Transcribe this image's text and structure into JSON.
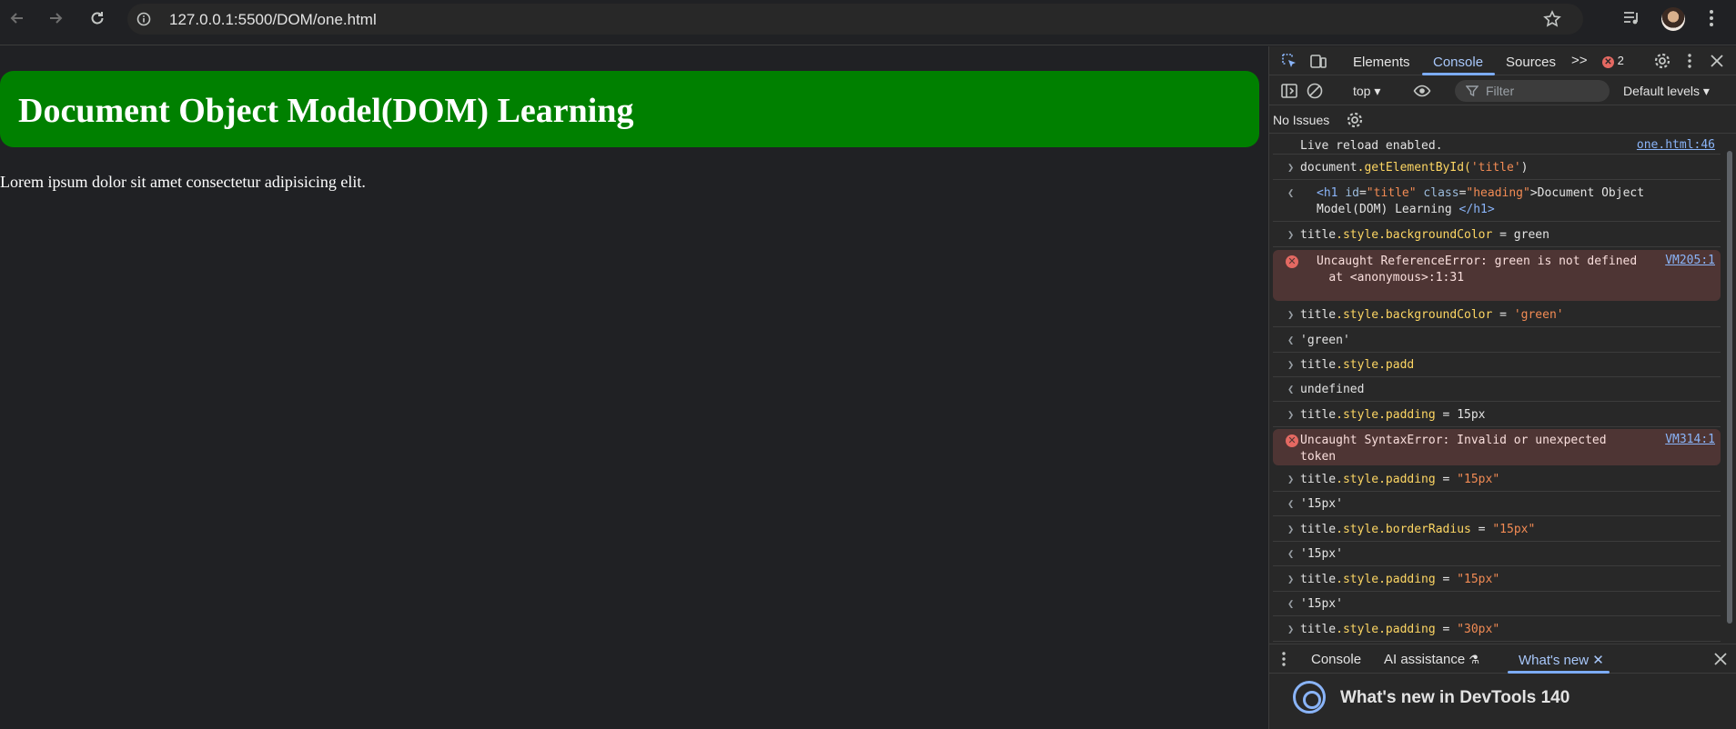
{
  "browser": {
    "url": "127.0.0.1:5500/DOM/one.html",
    "back_icon": "back-arrow-icon",
    "forward_icon": "forward-arrow-icon",
    "reload_icon": "reload-icon"
  },
  "page": {
    "heading": "Document Object Model(DOM) Learning",
    "paragraph": "Lorem ipsum dolor sit amet consectetur adipisicing elit."
  },
  "devtools": {
    "tabs": [
      "Elements",
      "Console",
      "Sources"
    ],
    "more_tabs": ">>",
    "error_count": "2",
    "context": "top ▾",
    "filter_placeholder": "Filter",
    "levels": "Default levels ▾",
    "issues": "No Issues"
  },
  "console": {
    "live_reload": "Live reload enabled.",
    "live_reload_link": "one.html:46",
    "r1_obj": "document",
    "r1_method": ".getElementById(",
    "r1_arg": "'title'",
    "r1_close": ")",
    "r2_open": "<h1",
    "r2_id_attr": "id",
    "r2_id_val": "\"title\"",
    "r2_class_attr": "class",
    "r2_class_val": "\"heading\"",
    "r2_text": ">Document Object Model(DOM) Learning",
    "r2_close": "</h1>",
    "cmd1_obj": "title",
    "cmd1_prop": ".style.backgroundColor",
    "cmd1_rest": " = green",
    "err1_text": "Uncaught ReferenceError: green is not defined\n    at <anonymous>:1:31",
    "err1_link": "VM205:1",
    "cmd2_obj": "title",
    "cmd2_prop": ".style.backgroundColor",
    "cmd2_eq": " = ",
    "cmd2_val": "'green'",
    "res2": "'green'",
    "cmd3_obj": "title",
    "cmd3_prop": ".style.padd",
    "res3": "undefined",
    "cmd4_obj": "title",
    "cmd4_prop": ".style.padding",
    "cmd4_rest": " = 15px",
    "err2_text": "Uncaught SyntaxError: Invalid or unexpected token",
    "err2_link": "VM314:1",
    "cmd5_obj": "title",
    "cmd5_prop": ".style.padding",
    "cmd5_eq": " = ",
    "cmd5_val": "\"15px\"",
    "res5": "'15px'",
    "cmd6_obj": "title",
    "cmd6_prop": ".style.borderRadius",
    "cmd6_eq": " = ",
    "cmd6_val": "\"15px\"",
    "res6": "'15px'",
    "cmd7_obj": "title",
    "cmd7_prop": ".style.padding",
    "cmd7_eq": " = ",
    "cmd7_val": "\"15px\"",
    "res7": "'15px'",
    "cmd8_obj": "title",
    "cmd8_prop": ".style.padding",
    "cmd8_eq": " = ",
    "cmd8_val": "\"30px\""
  },
  "drawer": {
    "tab_console": "Console",
    "tab_ai": "AI assistance",
    "tab_whatsnew": "What's new",
    "whatsnew_title": "What's new in DevTools 140"
  },
  "colors": {
    "heading_bg": "#008000",
    "error_bg": "#4e3534",
    "active_tab": "#a8c7fa"
  }
}
